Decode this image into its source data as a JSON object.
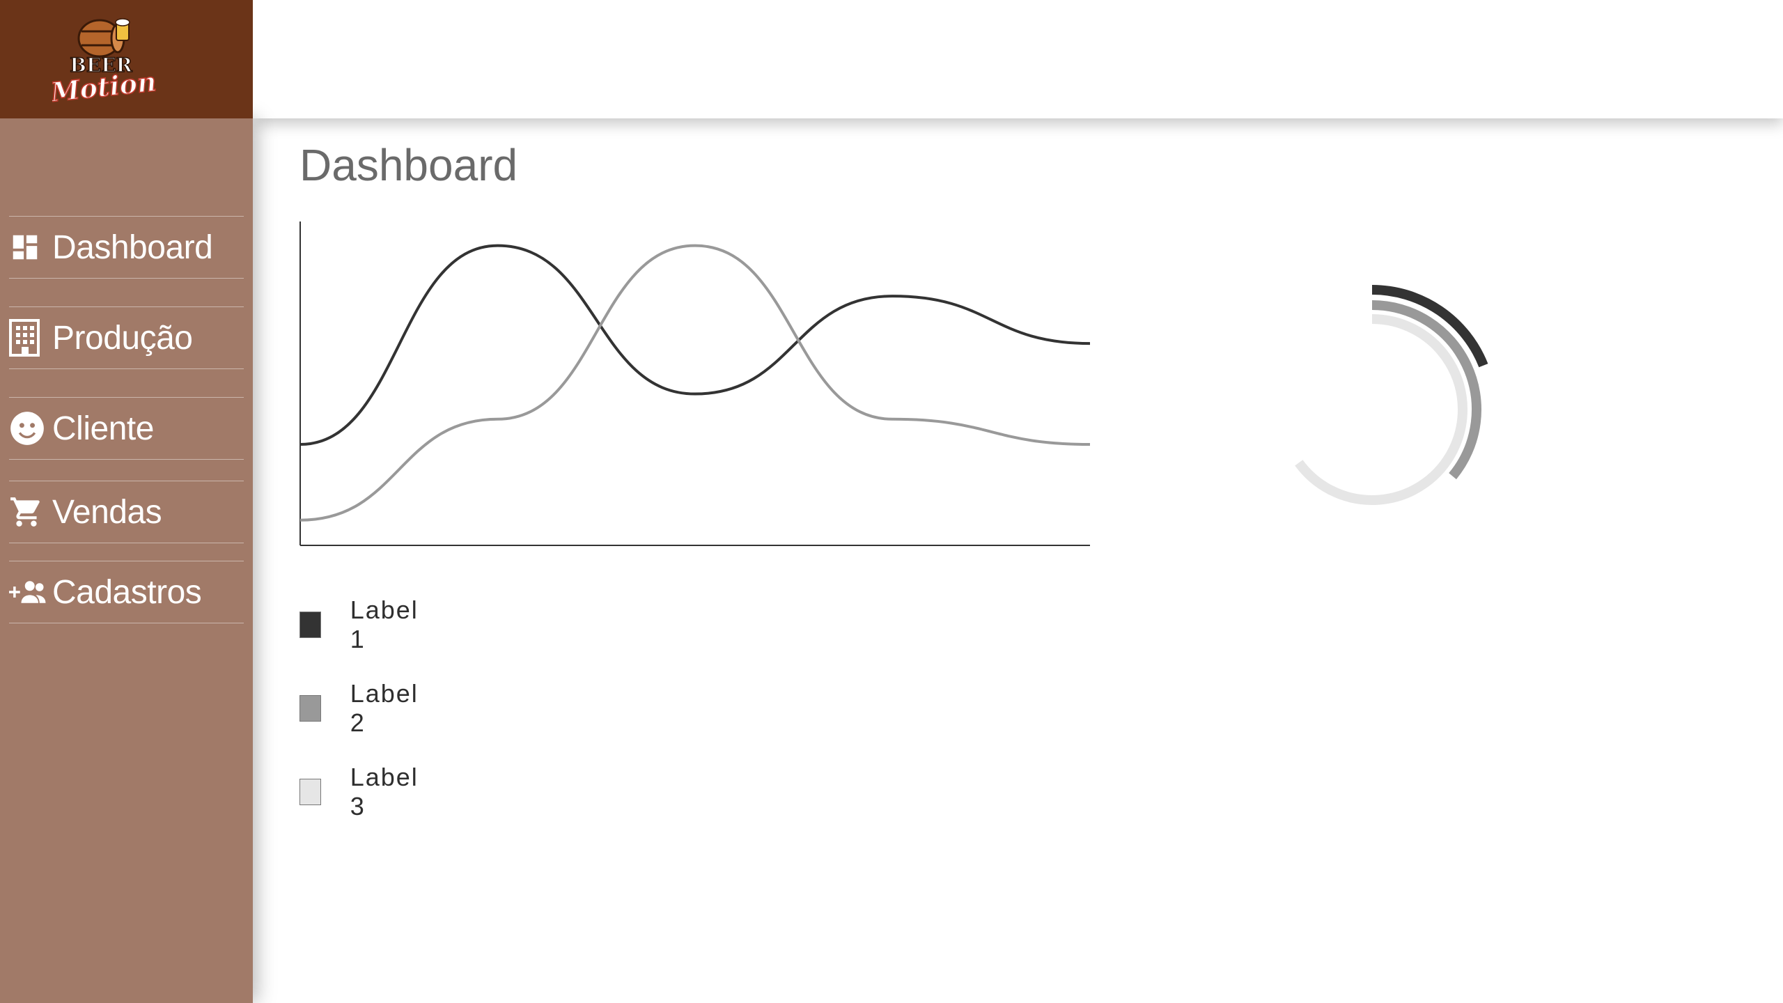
{
  "brand": {
    "line1": "BEER",
    "line2": "Motion",
    "colors": {
      "header_bg": "#6b3418",
      "sidebar_bg": "#a17a68"
    }
  },
  "sidebar": {
    "items": [
      {
        "label": "Dashboard",
        "icon": "dashboard-icon"
      },
      {
        "label": "Produção",
        "icon": "building-icon"
      },
      {
        "label": "Cliente",
        "icon": "face-icon"
      },
      {
        "label": "Vendas",
        "icon": "shopping-cart-icon"
      },
      {
        "label": "Cadastros",
        "icon": "add-group-icon"
      }
    ]
  },
  "main": {
    "title": "Dashboard"
  },
  "chart_data": [
    {
      "type": "line",
      "title": "",
      "xlabel": "",
      "ylabel": "",
      "grid": false,
      "x": [
        0,
        1,
        2,
        3,
        4
      ],
      "ylim": [
        0,
        100
      ],
      "series": [
        {
          "values": [
            32,
            95,
            48,
            79,
            64
          ],
          "color": "#333333"
        },
        {
          "values": [
            8,
            40,
            95,
            40,
            32
          ],
          "color": "#999999"
        }
      ]
    },
    {
      "type": "pie",
      "title": "",
      "style": "concentric-arc",
      "series": [
        {
          "name": "Label 1",
          "value": 0.19,
          "color": "#333333"
        },
        {
          "name": "Label 2",
          "value": 0.36,
          "color": "#999999"
        },
        {
          "name": "Label 3",
          "value": 0.65,
          "color": "#e6e6e6"
        }
      ]
    }
  ],
  "legend": {
    "items": [
      {
        "label": "Label 1",
        "color": "#333333"
      },
      {
        "label": "Label 2",
        "color": "#999999"
      },
      {
        "label": "Label 3",
        "color": "#e6e6e6"
      }
    ]
  }
}
